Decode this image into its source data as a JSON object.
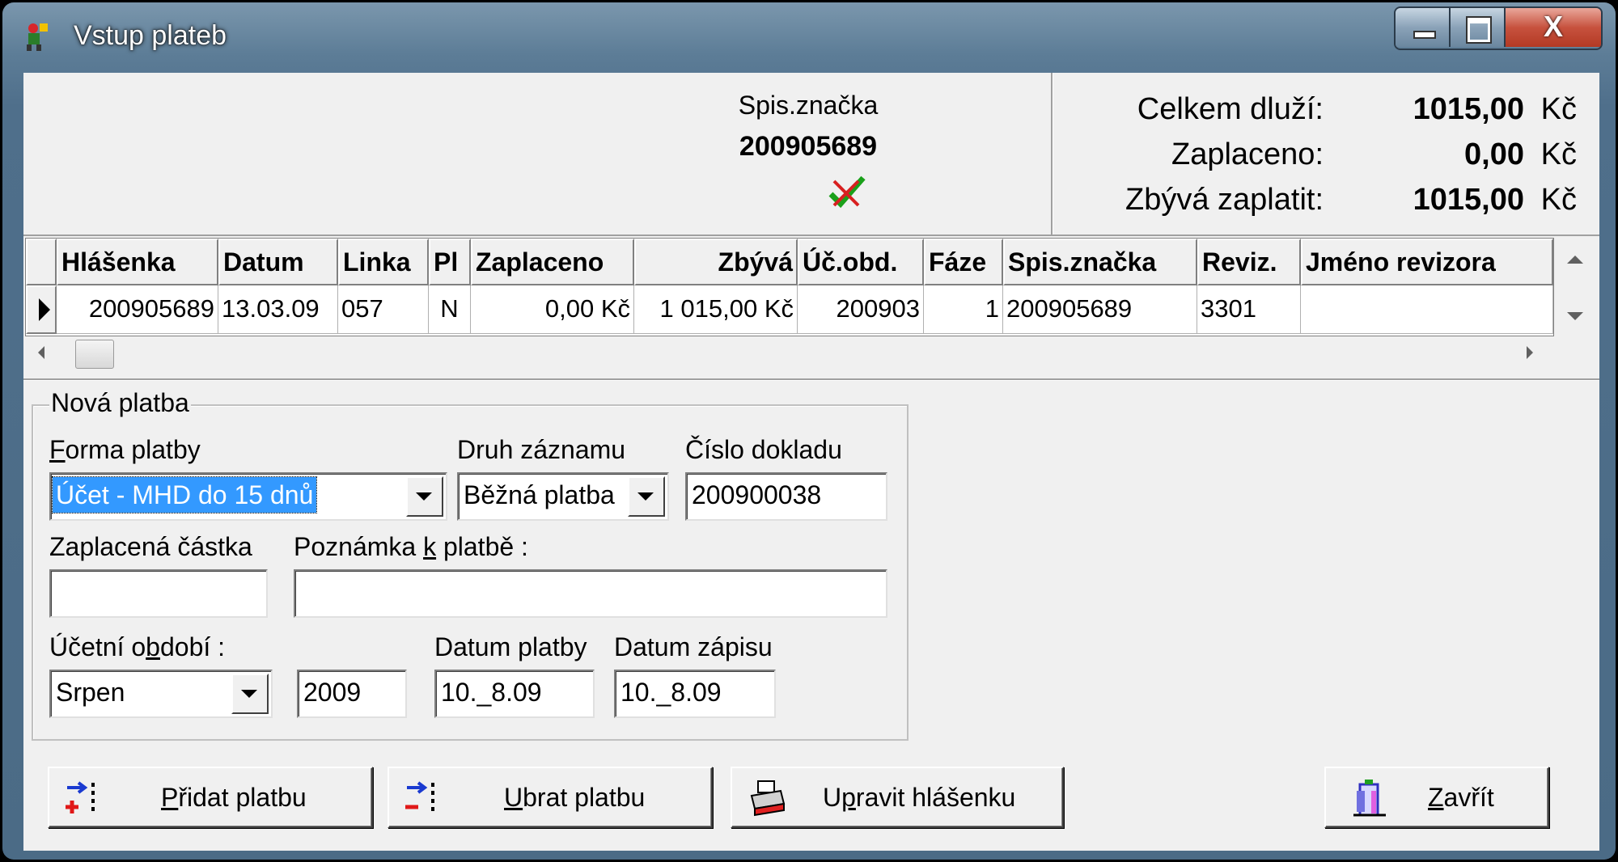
{
  "window": {
    "title": "Vstup plateb"
  },
  "header": {
    "spis_label": "Spis.značka",
    "spis_value": "200905689",
    "summary": [
      {
        "label": "Celkem dluží:",
        "value": "1015,00",
        "currency": "Kč"
      },
      {
        "label": "Zaplaceno:",
        "value": "0,00",
        "currency": "Kč"
      },
      {
        "label": "Zbývá zaplatit:",
        "value": "1015,00",
        "currency": "Kč"
      }
    ]
  },
  "grid": {
    "columns": [
      "Hlášenka",
      "Datum",
      "Linka",
      "Pl",
      "Zaplaceno",
      "Zbývá",
      "Úč.obd.",
      "Fáze",
      "Spis.značka",
      "Reviz.",
      "Jméno revizora"
    ],
    "rows": [
      [
        "200905689",
        "13.03.09",
        "057",
        "N",
        "0,00 Kč",
        "1 015,00 Kč",
        "200903",
        "1",
        "200905689",
        "3301",
        ""
      ]
    ]
  },
  "form": {
    "group_title": "Nová platba",
    "forma_platby": {
      "label_u": "F",
      "label_rest": "orma platby",
      "value": "Účet - MHD do 15 dnů"
    },
    "druh_zaznamu": {
      "label": "Druh záznamu",
      "value": "Běžná platba"
    },
    "cislo_dokladu": {
      "label": "Číslo dokladu",
      "value": "200900038"
    },
    "zaplacena_castka": {
      "label": "Zaplacená částka",
      "value": ""
    },
    "poznamka": {
      "label_pre": "Poznámka ",
      "label_u": "k",
      "label_post": " platbě :",
      "value": ""
    },
    "ucetni_obdobi": {
      "label_pre": "Účetní o",
      "label_u": "b",
      "label_post": "dobí :",
      "month": "Srpen",
      "year": "2009"
    },
    "datum_platby": {
      "label": "Datum platby",
      "value": "10._8.09"
    },
    "datum_zapisu": {
      "label": "Datum zápisu",
      "value": "10._8.09"
    }
  },
  "buttons": {
    "pridat": {
      "u": "P",
      "rest": "řidat platbu"
    },
    "ubrat": {
      "u": "U",
      "rest": "brat platbu"
    },
    "upravit": {
      "pre": "U",
      "u": "p",
      "rest": "ravit hlášenku"
    },
    "zavrit": {
      "u": "Z",
      "rest": "avřít"
    }
  }
}
